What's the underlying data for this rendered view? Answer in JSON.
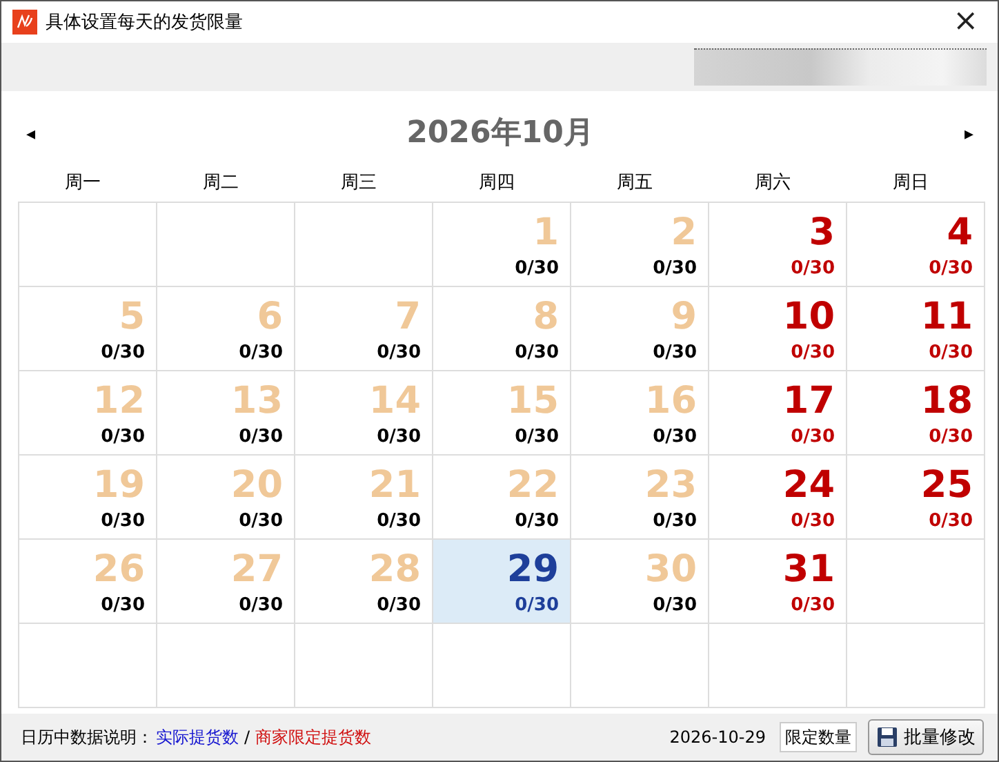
{
  "window": {
    "title": "具体设置每天的发货限量",
    "close": "×"
  },
  "calendar": {
    "prev": "◂",
    "next": "▸",
    "month": "2026年10月",
    "weekdays": [
      "周一",
      "周二",
      "周三",
      "周四",
      "周五",
      "周六",
      "周日"
    ],
    "weeks": [
      [
        {
          "kind": "empty"
        },
        {
          "kind": "empty"
        },
        {
          "kind": "empty"
        },
        {
          "kind": "weekday",
          "day": "1",
          "count": "0/30",
          "selected": false
        },
        {
          "kind": "weekday",
          "day": "2",
          "count": "0/30",
          "selected": false
        },
        {
          "kind": "weekend",
          "day": "3",
          "count": "0/30",
          "selected": false
        },
        {
          "kind": "weekend",
          "day": "4",
          "count": "0/30",
          "selected": false
        }
      ],
      [
        {
          "kind": "weekday",
          "day": "5",
          "count": "0/30",
          "selected": false
        },
        {
          "kind": "weekday",
          "day": "6",
          "count": "0/30",
          "selected": false
        },
        {
          "kind": "weekday",
          "day": "7",
          "count": "0/30",
          "selected": false
        },
        {
          "kind": "weekday",
          "day": "8",
          "count": "0/30",
          "selected": false
        },
        {
          "kind": "weekday",
          "day": "9",
          "count": "0/30",
          "selected": false
        },
        {
          "kind": "weekend",
          "day": "10",
          "count": "0/30",
          "selected": false
        },
        {
          "kind": "weekend",
          "day": "11",
          "count": "0/30",
          "selected": false
        }
      ],
      [
        {
          "kind": "weekday",
          "day": "12",
          "count": "0/30",
          "selected": false
        },
        {
          "kind": "weekday",
          "day": "13",
          "count": "0/30",
          "selected": false
        },
        {
          "kind": "weekday",
          "day": "14",
          "count": "0/30",
          "selected": false
        },
        {
          "kind": "weekday",
          "day": "15",
          "count": "0/30",
          "selected": false
        },
        {
          "kind": "weekday",
          "day": "16",
          "count": "0/30",
          "selected": false
        },
        {
          "kind": "weekend",
          "day": "17",
          "count": "0/30",
          "selected": false
        },
        {
          "kind": "weekend",
          "day": "18",
          "count": "0/30",
          "selected": false
        }
      ],
      [
        {
          "kind": "weekday",
          "day": "19",
          "count": "0/30",
          "selected": false
        },
        {
          "kind": "weekday",
          "day": "20",
          "count": "0/30",
          "selected": false
        },
        {
          "kind": "weekday",
          "day": "21",
          "count": "0/30",
          "selected": false
        },
        {
          "kind": "weekday",
          "day": "22",
          "count": "0/30",
          "selected": false
        },
        {
          "kind": "weekday",
          "day": "23",
          "count": "0/30",
          "selected": false
        },
        {
          "kind": "weekend",
          "day": "24",
          "count": "0/30",
          "selected": false
        },
        {
          "kind": "weekend",
          "day": "25",
          "count": "0/30",
          "selected": false
        }
      ],
      [
        {
          "kind": "weekday",
          "day": "26",
          "count": "0/30",
          "selected": false
        },
        {
          "kind": "weekday",
          "day": "27",
          "count": "0/30",
          "selected": false
        },
        {
          "kind": "weekday",
          "day": "28",
          "count": "0/30",
          "selected": false
        },
        {
          "kind": "weekday",
          "day": "29",
          "count": "0/30",
          "selected": true
        },
        {
          "kind": "weekday",
          "day": "30",
          "count": "0/30",
          "selected": false
        },
        {
          "kind": "weekend",
          "day": "31",
          "count": "0/30",
          "selected": false
        },
        {
          "kind": "empty"
        }
      ],
      [
        {
          "kind": "empty"
        },
        {
          "kind": "empty"
        },
        {
          "kind": "empty"
        },
        {
          "kind": "empty"
        },
        {
          "kind": "empty"
        },
        {
          "kind": "empty"
        },
        {
          "kind": "empty"
        }
      ]
    ]
  },
  "footer": {
    "legend_label": "日历中数据说明：",
    "legend_actual": "实际提货数",
    "legend_separator": "/",
    "legend_limit": "商家限定提货数",
    "date": "2026-10-29",
    "limit_field": {
      "value": "限定数量"
    },
    "batch_button": "批量修改"
  }
}
